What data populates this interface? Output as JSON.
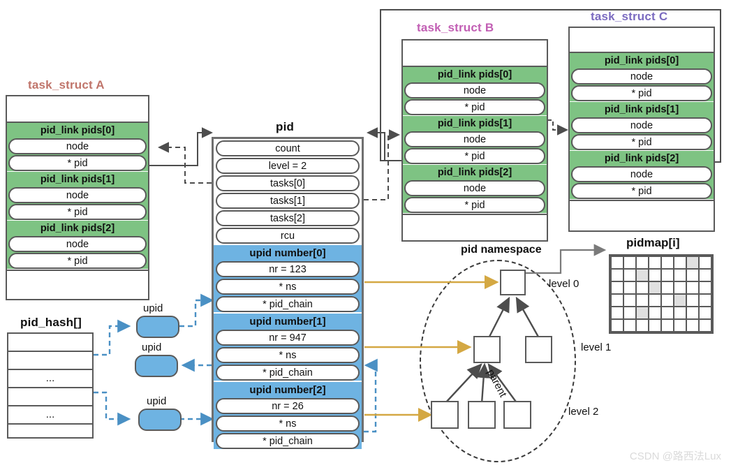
{
  "colors": {
    "green_header": "#7ec383",
    "blue_header": "#6eb3e2",
    "title_a": "#c0756b",
    "title_b": "#c25fb4",
    "title_c": "#7b6bc0",
    "gold_arrow": "#d4a843",
    "blue_arrow": "#4a90c4",
    "gray_line": "#5a5a5a",
    "pidmap_cell_on": "#e0e0e0"
  },
  "task_a": {
    "title": "task_struct A",
    "groups": [
      {
        "header": "pid_link pids[0]",
        "fields": [
          "node",
          "* pid"
        ]
      },
      {
        "header": "pid_link pids[1]",
        "fields": [
          "node",
          "* pid"
        ]
      },
      {
        "header": "pid_link pids[2]",
        "fields": [
          "node",
          "* pid"
        ]
      }
    ]
  },
  "task_b": {
    "title": "task_struct B",
    "groups": [
      {
        "header": "pid_link pids[0]",
        "fields": [
          "node",
          "* pid"
        ]
      },
      {
        "header": "pid_link pids[1]",
        "fields": [
          "node",
          "* pid"
        ]
      },
      {
        "header": "pid_link pids[2]",
        "fields": [
          "node",
          "* pid"
        ]
      }
    ]
  },
  "task_c": {
    "title": "task_struct C",
    "groups": [
      {
        "header": "pid_link pids[0]",
        "fields": [
          "node",
          "* pid"
        ]
      },
      {
        "header": "pid_link pids[1]",
        "fields": [
          "node",
          "* pid"
        ]
      },
      {
        "header": "pid_link pids[2]",
        "fields": [
          "node",
          "* pid"
        ]
      }
    ]
  },
  "pid": {
    "title": "pid",
    "fields": [
      "count",
      "level = 2",
      "tasks[0]",
      "tasks[1]",
      "tasks[2]",
      "rcu"
    ],
    "upids": [
      {
        "header": "upid number[0]",
        "nr": "nr = 123",
        "ns": "* ns",
        "chain": "* pid_chain"
      },
      {
        "header": "upid number[1]",
        "nr": "nr = 947",
        "ns": "* ns",
        "chain": "* pid_chain"
      },
      {
        "header": "upid number[2]",
        "nr": "nr = 26",
        "ns": "* ns",
        "chain": "* pid_chain"
      }
    ]
  },
  "pid_hash": {
    "title": "pid_hash[]",
    "rows": [
      "",
      "",
      "...",
      "",
      "...",
      ""
    ]
  },
  "upid_bubbles": [
    {
      "label": "upid"
    },
    {
      "label": "upid"
    },
    {
      "label": "upid"
    }
  ],
  "namespace": {
    "title": "pid namespace",
    "parent_label": "parent",
    "levels": [
      "level 0",
      "level 1",
      "level 2"
    ],
    "nodes_per_level": [
      1,
      2,
      3
    ]
  },
  "pidmap": {
    "title": "pidmap[i]",
    "cols": 8,
    "rows": 6,
    "filled": [
      [
        0,
        6
      ],
      [
        1,
        2
      ],
      [
        2,
        3
      ],
      [
        3,
        5
      ],
      [
        4,
        2
      ]
    ]
  },
  "watermark": "CSDN @路西法Lux"
}
